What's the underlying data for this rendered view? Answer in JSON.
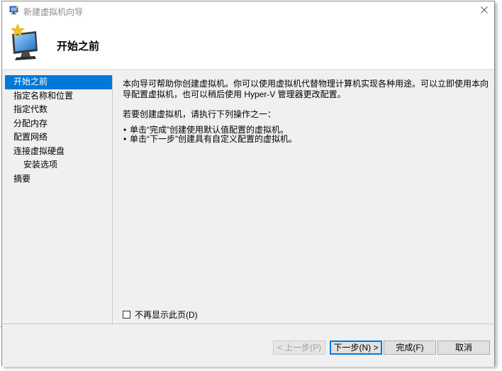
{
  "window": {
    "title": "新建虚拟机向导"
  },
  "header": {
    "title": "开始之前"
  },
  "nav": {
    "items": [
      {
        "label": "开始之前",
        "active": true,
        "sub": false
      },
      {
        "label": "指定名称和位置",
        "active": false,
        "sub": false
      },
      {
        "label": "指定代数",
        "active": false,
        "sub": false
      },
      {
        "label": "分配内存",
        "active": false,
        "sub": false
      },
      {
        "label": "配置网络",
        "active": false,
        "sub": false
      },
      {
        "label": "连接虚拟硬盘",
        "active": false,
        "sub": false
      },
      {
        "label": "安装选项",
        "active": false,
        "sub": true
      },
      {
        "label": "摘要",
        "active": false,
        "sub": false
      }
    ]
  },
  "content": {
    "paragraph1": "本向导可帮助你创建虚拟机。你可以使用虚拟机代替物理计算机实现各种用途。可以立即使用本向导配置虚拟机，也可以稍后使用 Hyper-V 管理器更改配置。",
    "paragraph2": "若要创建虚拟机，请执行下列操作之一：",
    "bullets": [
      "单击“完成”创建使用默认值配置的虚拟机。",
      "单击“下一步”创建具有自定义配置的虚拟机。"
    ]
  },
  "checkbox": {
    "label": "不再显示此页(D)",
    "checked": false
  },
  "buttons": {
    "prev": "< 上一步(P)",
    "next": "下一步(N) >",
    "finish": "完成(F)",
    "cancel": "取消"
  },
  "colors": {
    "accent": "#0078d7",
    "panel": "#f0f0f0"
  },
  "icons": {
    "title": "hyperv-vm-icon",
    "header": "monitor-star-icon",
    "close": "close-icon"
  }
}
